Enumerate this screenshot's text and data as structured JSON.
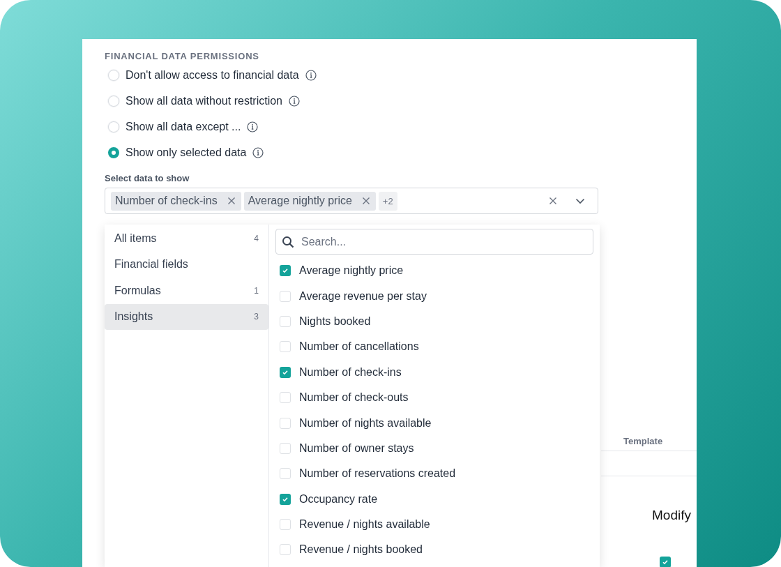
{
  "section_title": "FINANCIAL DATA PERMISSIONS",
  "options": [
    {
      "label": "Don't allow access to financial data",
      "selected": false
    },
    {
      "label": "Show all data without restriction",
      "selected": false
    },
    {
      "label": "Show all data except ...",
      "selected": false
    },
    {
      "label": "Show only selected data",
      "selected": true
    }
  ],
  "select": {
    "label": "Select data to show",
    "chips": [
      "Number of check-ins",
      "Average nightly price"
    ],
    "more": "+2"
  },
  "dropdown": {
    "categories": [
      {
        "label": "All items",
        "count": "4",
        "selected": false
      },
      {
        "label": "Financial fields",
        "selected": false
      },
      {
        "label": "Formulas",
        "count": "1",
        "selected": false
      },
      {
        "label": "Insights",
        "count": "3",
        "selected": true
      }
    ],
    "search_placeholder": "Search...",
    "items": [
      {
        "label": "Average nightly price",
        "checked": true
      },
      {
        "label": "Average revenue per stay",
        "checked": false
      },
      {
        "label": "Nights booked",
        "checked": false
      },
      {
        "label": "Number of cancellations",
        "checked": false
      },
      {
        "label": "Number of check-ins",
        "checked": true
      },
      {
        "label": "Number of check-outs",
        "checked": false
      },
      {
        "label": "Number of nights available",
        "checked": false
      },
      {
        "label": "Number of owner stays",
        "checked": false
      },
      {
        "label": "Number of reservations created",
        "checked": false
      },
      {
        "label": "Occupancy rate",
        "checked": true
      },
      {
        "label": "Revenue / nights available",
        "checked": false
      },
      {
        "label": "Revenue / nights booked",
        "checked": false
      }
    ]
  },
  "table_behind": {
    "column": "Template",
    "action": "Modify",
    "checked": true
  }
}
